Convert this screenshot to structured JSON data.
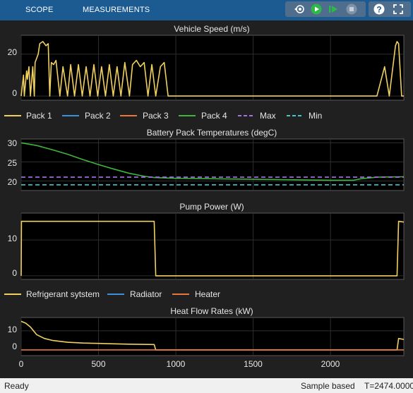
{
  "toolbar": {
    "tabs": [
      "SCOPE",
      "MEASUREMENTS"
    ],
    "buttons": [
      "step-back-icon",
      "run-icon",
      "step-forward-icon",
      "stop-icon",
      "help-icon",
      "expand-icon"
    ]
  },
  "status": {
    "left": "Ready",
    "mode": "Sample based",
    "time": "T=2474.0000"
  },
  "colors": {
    "pack1": "#f0d060",
    "pack2": "#3d8fd8",
    "pack3": "#e8783a",
    "pack4": "#3fb43f",
    "max": "#a872e8",
    "min": "#42c8c8",
    "refrigerant": "#f0d060",
    "radiator": "#3d8fd8",
    "heater": "#e8783a"
  },
  "legends": {
    "packs": [
      "Pack 1",
      "Pack 2",
      "Pack 3",
      "Pack 4",
      "Max",
      "Min"
    ],
    "heat": [
      "Refrigerant sytstem",
      "Radiator",
      "Heater"
    ]
  },
  "x_ticks": [
    "0",
    "500",
    "1000",
    "1500",
    "2000"
  ],
  "chart_data": [
    {
      "type": "line",
      "title": "Vehicle Speed (m/s)",
      "xlim": [
        0,
        2474
      ],
      "ylim": [
        -2,
        29
      ],
      "yticks": [
        "0",
        "20"
      ],
      "series": [
        {
          "name": "",
          "x": [
            0,
            15,
            20,
            35,
            40,
            50,
            60,
            75,
            85,
            90,
            100,
            110,
            120,
            140,
            160,
            175,
            185,
            195,
            210,
            225,
            250,
            270,
            300,
            320,
            345,
            370,
            395,
            420,
            445,
            470,
            495,
            520,
            545,
            570,
            595,
            620,
            645,
            670,
            700,
            720,
            745,
            770,
            795,
            820,
            845,
            870,
            900,
            925,
            950,
            1020,
            1400,
            1800,
            2300,
            2350,
            2380,
            2420,
            2430,
            2440,
            2460,
            2474
          ],
          "y": [
            0,
            10,
            0,
            12,
            8,
            14,
            0,
            14,
            0,
            16,
            18,
            20,
            25,
            26,
            24,
            25,
            0,
            16,
            15,
            17,
            0,
            14,
            0,
            15,
            0,
            15,
            0,
            14,
            0,
            15,
            0,
            14,
            0,
            15,
            0,
            14,
            0,
            16,
            0,
            15,
            17,
            14,
            16,
            0,
            15,
            0,
            14,
            16,
            0,
            0,
            0,
            0,
            0,
            14,
            0,
            24,
            26,
            25,
            0,
            0
          ]
        }
      ]
    },
    {
      "type": "line",
      "title": "Battery Pack Temperatures (degC)",
      "xlim": [
        0,
        2474
      ],
      "ylim": [
        17.5,
        31
      ],
      "yticks": [
        "20",
        "25",
        "30"
      ],
      "series": [
        {
          "name": "Pack 4",
          "x": [
            0,
            100,
            200,
            300,
            400,
            500,
            600,
            700,
            800,
            860,
            1000,
            1200,
            1400,
            1600,
            1800,
            2000,
            2150,
            2200,
            2300,
            2474
          ],
          "y": [
            30,
            29.3,
            28.2,
            27,
            25.6,
            24.3,
            23.1,
            22,
            21.2,
            20.9,
            20.7,
            20.6,
            20.5,
            20.4,
            20.3,
            20.2,
            20.2,
            20.6,
            21,
            21.1
          ]
        },
        {
          "name": "Max",
          "x": [
            0,
            2474
          ],
          "y": [
            21,
            21
          ]
        },
        {
          "name": "Min",
          "x": [
            0,
            2474
          ],
          "y": [
            19,
            19
          ]
        }
      ]
    },
    {
      "type": "line",
      "title": "Pump Power (W)",
      "xlim": [
        0,
        2474
      ],
      "ylim": [
        -1,
        17.5
      ],
      "yticks": [
        "0",
        "10"
      ],
      "series": [
        {
          "name": "Refrigerant sytstem",
          "x": [
            0,
            2,
            860,
            870,
            2430,
            2440,
            2474
          ],
          "y": [
            0,
            15.2,
            15.2,
            0,
            0,
            15.2,
            15
          ]
        }
      ]
    },
    {
      "type": "line",
      "title": "Heat Flow Rates (kW)",
      "xlim": [
        0,
        2474
      ],
      "ylim": [
        -3,
        17
      ],
      "yticks": [
        "0",
        "10"
      ],
      "series": [
        {
          "name": "Refrigerant sytstem",
          "x": [
            0,
            30,
            60,
            100,
            150,
            200,
            300,
            400,
            500,
            600,
            700,
            860,
            870,
            2430,
            2440,
            2474
          ],
          "y": [
            15,
            14,
            12,
            8,
            6,
            5,
            4,
            3.6,
            3.4,
            3.2,
            3,
            2.8,
            0,
            0,
            6,
            5.5
          ]
        },
        {
          "name": "Heater",
          "x": [
            0,
            2474
          ],
          "y": [
            0,
            0
          ]
        }
      ]
    }
  ]
}
